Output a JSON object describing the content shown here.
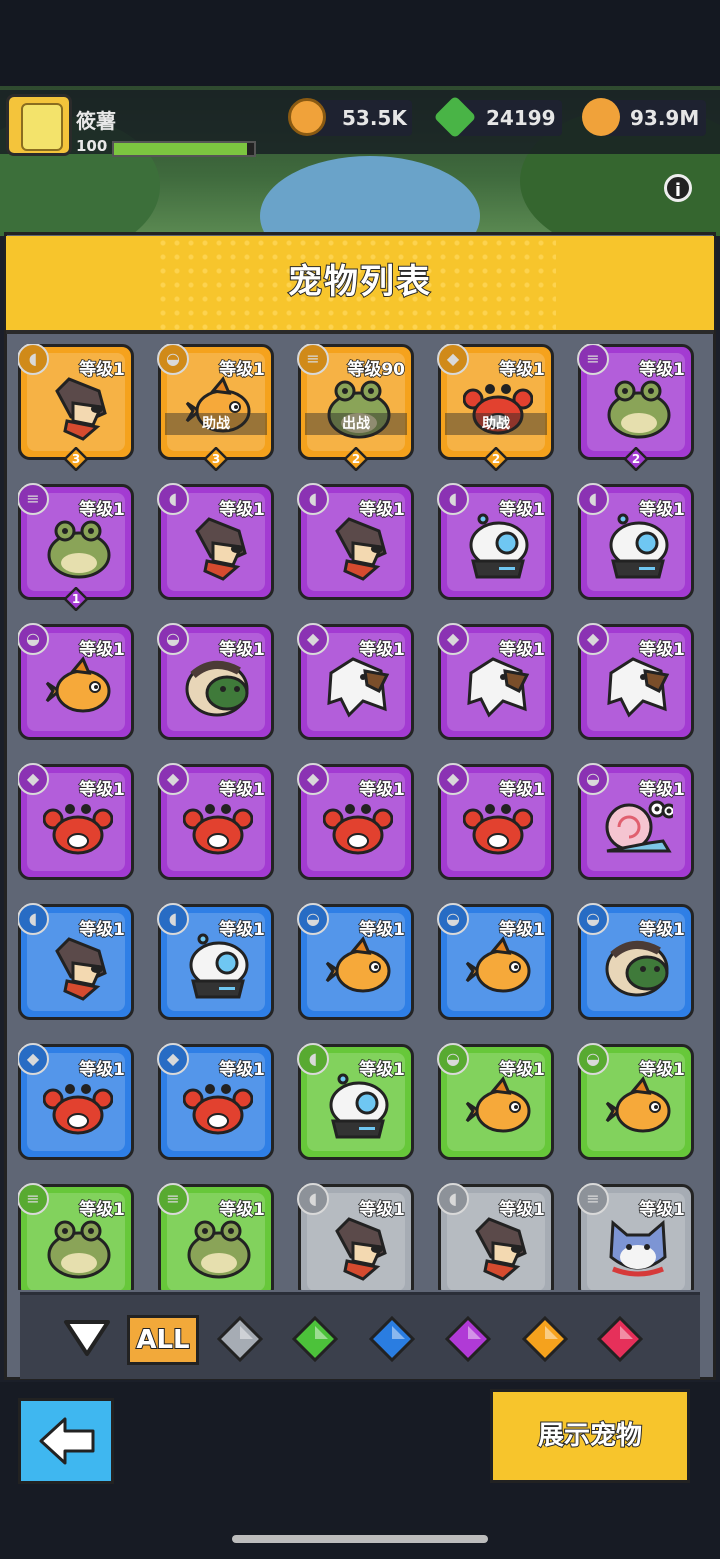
{
  "player": {
    "name": "筱薯",
    "level": "100",
    "xp_progress": 0.98
  },
  "resources": [
    {
      "icon": "coin-icon",
      "value": "53.5K",
      "color": "#f0a23a"
    },
    {
      "icon": "green-gem-plus-icon",
      "value": "24199",
      "color": "#49b446"
    },
    {
      "icon": "gold-plus-icon",
      "value": "93.9M",
      "color": "#f0a23a"
    }
  ],
  "panel": {
    "title": "宠物列表"
  },
  "colors": {
    "orange": "#f5a21d",
    "purple": "#a33bd2",
    "blue": "#2f7fe6",
    "green": "#67c83a",
    "gray": "#a6acb4"
  },
  "pets": [
    {
      "rarity": "orange",
      "pet": "dog",
      "element": "wolf",
      "level": "等级1",
      "stars": "3",
      "status": ""
    },
    {
      "rarity": "orange",
      "pet": "fish",
      "element": "shell",
      "level": "等级1",
      "stars": "3",
      "status": "助战"
    },
    {
      "rarity": "orange",
      "pet": "frog",
      "element": "coins",
      "level": "等级90",
      "stars": "2",
      "status": "出战"
    },
    {
      "rarity": "orange",
      "pet": "crab",
      "element": "beast",
      "level": "等级1",
      "stars": "2",
      "status": "助战"
    },
    {
      "rarity": "purple",
      "pet": "frog",
      "element": "coins",
      "level": "等级1",
      "stars": "2",
      "status": ""
    },
    {
      "rarity": "purple",
      "pet": "frog",
      "element": "coins",
      "level": "等级1",
      "stars": "1",
      "status": ""
    },
    {
      "rarity": "purple",
      "pet": "dog",
      "element": "wolf",
      "level": "等级1",
      "stars": "",
      "status": ""
    },
    {
      "rarity": "purple",
      "pet": "dog",
      "element": "wolf",
      "level": "等级1",
      "stars": "",
      "status": ""
    },
    {
      "rarity": "purple",
      "pet": "robot",
      "element": "wolf",
      "level": "等级1",
      "stars": "",
      "status": ""
    },
    {
      "rarity": "purple",
      "pet": "robot",
      "element": "wolf",
      "level": "等级1",
      "stars": "",
      "status": ""
    },
    {
      "rarity": "purple",
      "pet": "fish",
      "element": "shell",
      "level": "等级1",
      "stars": "",
      "status": ""
    },
    {
      "rarity": "purple",
      "pet": "turtle",
      "element": "shell",
      "level": "等级1",
      "stars": "",
      "status": ""
    },
    {
      "rarity": "purple",
      "pet": "eagle",
      "element": "beast",
      "level": "等级1",
      "stars": "",
      "status": ""
    },
    {
      "rarity": "purple",
      "pet": "eagle",
      "element": "beast",
      "level": "等级1",
      "stars": "",
      "status": ""
    },
    {
      "rarity": "purple",
      "pet": "eagle",
      "element": "beast",
      "level": "等级1",
      "stars": "",
      "status": ""
    },
    {
      "rarity": "purple",
      "pet": "crab",
      "element": "beast",
      "level": "等级1",
      "stars": "",
      "status": ""
    },
    {
      "rarity": "purple",
      "pet": "crab",
      "element": "beast",
      "level": "等级1",
      "stars": "",
      "status": ""
    },
    {
      "rarity": "purple",
      "pet": "crab",
      "element": "beast",
      "level": "等级1",
      "stars": "",
      "status": ""
    },
    {
      "rarity": "purple",
      "pet": "crab",
      "element": "beast",
      "level": "等级1",
      "stars": "",
      "status": ""
    },
    {
      "rarity": "purple",
      "pet": "snail",
      "element": "shell",
      "level": "等级1",
      "stars": "",
      "status": ""
    },
    {
      "rarity": "blue",
      "pet": "dog",
      "element": "wolf",
      "level": "等级1",
      "stars": "",
      "status": ""
    },
    {
      "rarity": "blue",
      "pet": "robot",
      "element": "wolf",
      "level": "等级1",
      "stars": "",
      "status": ""
    },
    {
      "rarity": "blue",
      "pet": "fish",
      "element": "shell",
      "level": "等级1",
      "stars": "",
      "status": ""
    },
    {
      "rarity": "blue",
      "pet": "fish",
      "element": "shell",
      "level": "等级1",
      "stars": "",
      "status": ""
    },
    {
      "rarity": "blue",
      "pet": "turtle",
      "element": "shell",
      "level": "等级1",
      "stars": "",
      "status": ""
    },
    {
      "rarity": "blue",
      "pet": "crab",
      "element": "beast",
      "level": "等级1",
      "stars": "",
      "status": ""
    },
    {
      "rarity": "blue",
      "pet": "crab",
      "element": "beast",
      "level": "等级1",
      "stars": "",
      "status": ""
    },
    {
      "rarity": "green",
      "pet": "robot",
      "element": "wolf",
      "level": "等级1",
      "stars": "",
      "status": ""
    },
    {
      "rarity": "green",
      "pet": "fish",
      "element": "shell",
      "level": "等级1",
      "stars": "",
      "status": ""
    },
    {
      "rarity": "green",
      "pet": "fish",
      "element": "shell",
      "level": "等级1",
      "stars": "",
      "status": ""
    },
    {
      "rarity": "green",
      "pet": "frog",
      "element": "coins",
      "level": "等级1",
      "stars": "",
      "status": ""
    },
    {
      "rarity": "green",
      "pet": "frog",
      "element": "coins",
      "level": "等级1",
      "stars": "",
      "status": ""
    },
    {
      "rarity": "gray",
      "pet": "dog",
      "element": "wolf",
      "level": "等级1",
      "stars": "",
      "status": ""
    },
    {
      "rarity": "gray",
      "pet": "dog",
      "element": "wolf",
      "level": "等级1",
      "stars": "",
      "status": ""
    },
    {
      "rarity": "gray",
      "pet": "cat",
      "element": "coins",
      "level": "等级1",
      "stars": "",
      "status": ""
    }
  ],
  "filters": {
    "dropdown_icon": "triangle-down-icon",
    "all_label": "ALL",
    "gems": [
      {
        "name": "gray-gem-icon",
        "color": "#a6acb4"
      },
      {
        "name": "green-gem-icon",
        "color": "#4cc23a"
      },
      {
        "name": "blue-gem-icon",
        "color": "#2a7de1"
      },
      {
        "name": "purple-gem-icon",
        "color": "#b03ad6"
      },
      {
        "name": "orange-gem-icon",
        "color": "#f5a21d"
      },
      {
        "name": "red-gem-icon",
        "color": "#e6305a"
      }
    ]
  },
  "bottom": {
    "back_icon": "back-arrow-icon",
    "show_label": "展示宠物"
  }
}
